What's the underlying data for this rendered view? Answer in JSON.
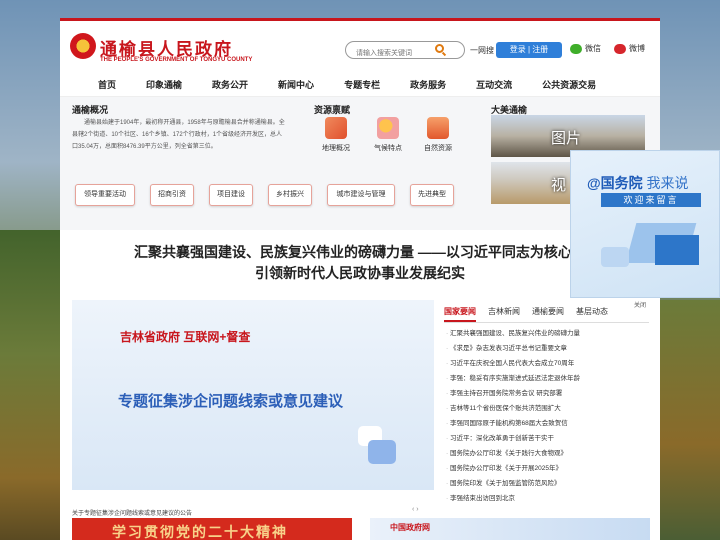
{
  "site": {
    "name_cn": "通榆县人民政府",
    "name_en": "THE PEOPLE'S GOVERNMENT OF TONGYU COUNTY"
  },
  "header": {
    "search_placeholder": "请输入搜索关键词",
    "one_search": "一网搜",
    "login": "登录",
    "register": "注册",
    "wechat": "微信",
    "weibo": "微博"
  },
  "nav": [
    "首页",
    "印象通榆",
    "政务公开",
    "新闻中心",
    "专题专栏",
    "政务服务",
    "互动交流",
    "公共资源交易"
  ],
  "overview": {
    "title": "通榆概况",
    "text": "通榆县始建于1904年，最初称开通县，1958年与原瞻榆县合并称通榆县。全县辖2个街道、10个社区、16个乡镇、172个行政村，1个省级经济开发区，总人口35.04万，总面积8476.39平方公里，列全省第三位。"
  },
  "resources": {
    "title": "资源禀赋",
    "items": [
      "地理概况",
      "气候特点",
      "自然资源"
    ]
  },
  "beauty": {
    "title": "大美通榆",
    "photo_label": "图片",
    "video_label": "视"
  },
  "quick_buttons": [
    "领导重要活动",
    "招商引资",
    "项目建设",
    "乡村振兴",
    "城市建设与管理",
    "先进典型"
  ],
  "headline": {
    "line1": "汇聚共襄强国建设、民族复兴伟业的磅礴力量 ——以习近平同志为核心的",
    "line2": "引领新时代人民政协事业发展纪实"
  },
  "banner": {
    "title1": "吉林省政府 互联网+督查",
    "title2": "专题征集涉企问题线索或意见建议",
    "caption": "关于专题征集涉企问题线索或意见建议的公告",
    "arrows": "‹ ›"
  },
  "news_tabs": [
    "国家要闻",
    "吉林新闻",
    "通榆要闻",
    "基层动态"
  ],
  "news": [
    "汇聚共襄强国建设、民族复兴伟业的磅礴力量",
    "《求是》杂志发表习近平总书记重要文章",
    "习近平在庆祝全国人民代表大会成立70周年",
    "李强：稳妥有序实施渐进式延迟法定退休年龄",
    "李强主持召开国务院常务会议 研究部署",
    "吉林等11个省份医保个账共济范围扩大",
    "李强同国际原子能机构第68届大会致贺信",
    "习近平：深化改革勇于创新苦干实干",
    "国务院办公厅印发《关于践行大食物观》",
    "国务院办公厅印发《关于开展2025年》",
    "国务院印发《关于加强监管防范风险》",
    "李强结束出访回到北京"
  ],
  "bottom": {
    "left": "学习贯彻党的二十大精神",
    "right": "中国政府网"
  },
  "ad": {
    "title_at": "@国务院",
    "title_rest": "我来说",
    "subtitle": "欢迎来留言",
    "close": "关闭"
  }
}
